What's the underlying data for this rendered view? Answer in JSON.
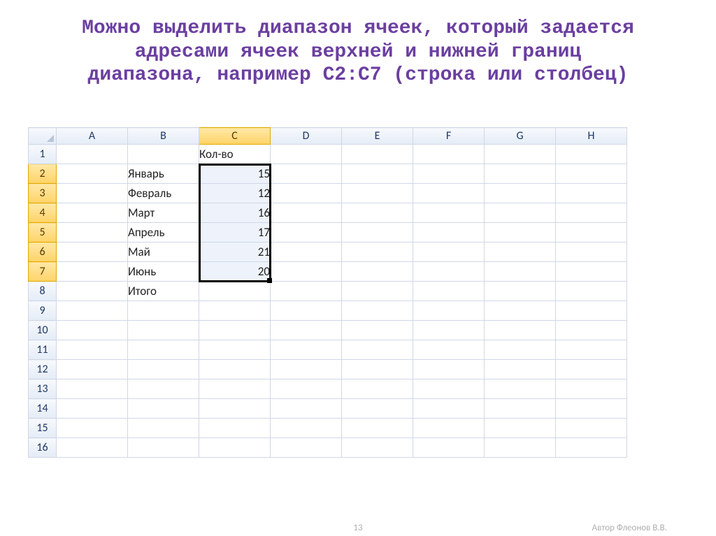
{
  "heading_lines": [
    "Можно выделить диапазон ячеек, который задается",
    "адресами ячеек верхней и нижней границ",
    "диапазона, например С2:С7 (строка или столбец)"
  ],
  "columns": [
    "A",
    "B",
    "C",
    "D",
    "E",
    "F",
    "G",
    "H"
  ],
  "active_column": "C",
  "row_count": 16,
  "active_rows": [
    2,
    3,
    4,
    5,
    6,
    7
  ],
  "selection": {
    "col": "C",
    "row_start": 2,
    "row_end": 7
  },
  "cells": {
    "C1": "Кол-во",
    "B2": "Январь",
    "C2": "15",
    "B3": "Февраль",
    "C3": "12",
    "B4": "Март",
    "C4": "16",
    "B5": "Апрель",
    "C5": "17",
    "B6": "Май",
    "C6": "21",
    "B7": "Июнь",
    "C7": "20",
    "B8": "Итого"
  },
  "numeric_cells": [
    "C2",
    "C3",
    "C4",
    "C5",
    "C6",
    "C7"
  ],
  "footer": {
    "page": "13",
    "author": "Автор Флеонов В.В."
  }
}
